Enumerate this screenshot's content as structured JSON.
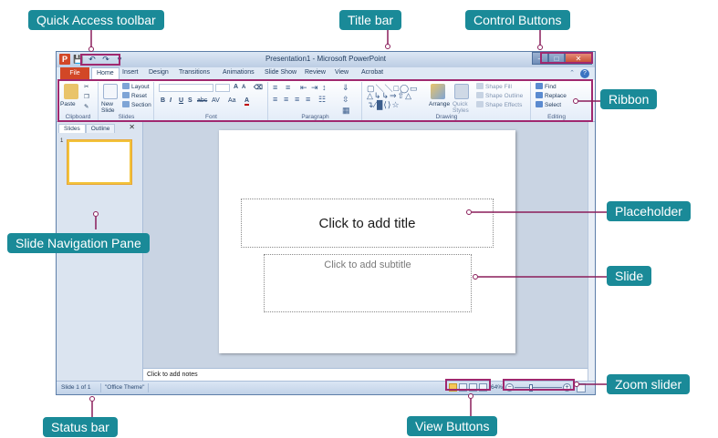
{
  "window": {
    "title": "Presentation1 - Microsoft PowerPoint",
    "app_icon": "P",
    "qat": [
      "save-icon",
      "undo-icon",
      "redo-icon",
      "customize-icon"
    ],
    "controls": [
      "minimize-icon",
      "maximize-icon",
      "close-icon"
    ]
  },
  "tabs": [
    "File",
    "Home",
    "Insert",
    "Design",
    "Transitions",
    "Animations",
    "Slide Show",
    "Review",
    "View",
    "Acrobat"
  ],
  "active_tab": "Home",
  "ribbon": {
    "clipboard": {
      "label": "Clipboard",
      "paste": "Paste"
    },
    "slides": {
      "label": "Slides",
      "new_slide": "New Slide",
      "layout": "Layout",
      "reset": "Reset",
      "section": "Section"
    },
    "font": {
      "label": "Font",
      "grow": "A",
      "shrink": "A",
      "bold": "B",
      "italic": "I",
      "underline": "U",
      "shadow": "S",
      "strike": "abc",
      "spacing": "AV",
      "case": "Aa",
      "color": "A"
    },
    "paragraph": {
      "label": "Paragraph"
    },
    "drawing": {
      "label": "Drawing",
      "arrange": "Arrange",
      "quick_styles": "Quick Styles",
      "shape_fill": "Shape Fill",
      "shape_outline": "Shape Outline",
      "shape_effects": "Shape Effects"
    },
    "editing": {
      "label": "Editing",
      "find": "Find",
      "replace": "Replace",
      "select": "Select"
    }
  },
  "nav": {
    "tabs": [
      "Slides",
      "Outline"
    ],
    "thumb_number": "1"
  },
  "slide": {
    "title_placeholder": "Click to add title",
    "subtitle_placeholder": "Click to add subtitle"
  },
  "notes_placeholder": "Click to add notes",
  "status": {
    "slide_count": "Slide 1 of 1",
    "theme": "\"Office Theme\"",
    "zoom": "64%",
    "zoom_minus": "−",
    "zoom_plus": "+"
  },
  "zoom_level": 0.35,
  "callouts": {
    "qat": "Quick Access toolbar",
    "title_bar": "Title bar",
    "controls": "Control Buttons",
    "ribbon": "Ribbon",
    "placeholder": "Placeholder",
    "slide": "Slide",
    "nav_pane": "Slide Navigation Pane",
    "zoom": "Zoom slider",
    "status": "Status bar",
    "view": "View Buttons"
  },
  "colors": {
    "callout_bg": "#1a8a98",
    "highlight": "#a0286f",
    "file_tab": "#d24726"
  }
}
